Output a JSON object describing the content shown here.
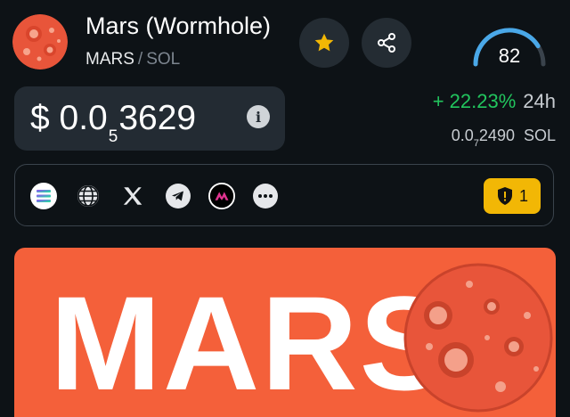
{
  "token": {
    "name": "Mars (Wormhole)",
    "symbol": "MARS",
    "separator": "/",
    "quote": "SOL"
  },
  "score": {
    "value": "82",
    "level": 0.82
  },
  "price": {
    "prefix": "$ 0.0",
    "zeros_subscript": "5",
    "digits": "3629",
    "change": "+ 22.23%",
    "period": "24h",
    "sol_prefix": "0.0",
    "sol_subscript": "7",
    "sol_digits": "2490",
    "sol_unit": "SOL"
  },
  "links": {
    "icons": [
      "solana-icon",
      "website-icon",
      "x-twitter-icon",
      "telegram-icon",
      "exchange-logo-icon",
      "more-icon"
    ]
  },
  "security": {
    "warnings": "1"
  },
  "banner": {
    "text": "MARS"
  },
  "colors": {
    "background": "#0d1216",
    "card": "#232b33",
    "positive": "#22c55e",
    "accent_yellow": "#f2b705",
    "banner": "#f4603a",
    "gauge": "#4aa8e8"
  }
}
